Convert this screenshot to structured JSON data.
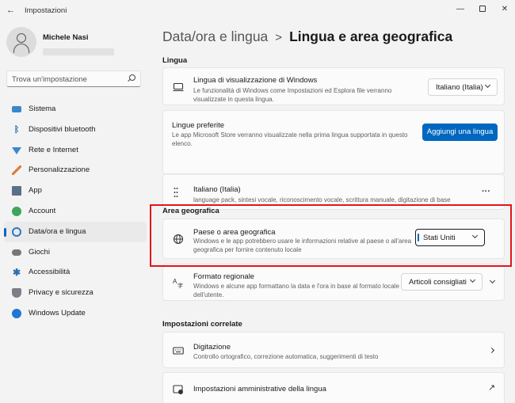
{
  "window": {
    "title": "Impostazioni",
    "back_glyph": "←",
    "minimize_glyph": "—",
    "close_glyph": "✕"
  },
  "user": {
    "name": "Michele Nasi"
  },
  "search": {
    "placeholder": "Trova un'impostazione"
  },
  "sidebar": {
    "items": [
      {
        "label": "Sistema",
        "icon": "system-icon"
      },
      {
        "label": "Dispositivi bluetooth",
        "icon": "bluetooth-icon",
        "glyph": "ᛒ"
      },
      {
        "label": "Rete e Internet",
        "icon": "wifi-icon"
      },
      {
        "label": "Personalizzazione",
        "icon": "brush-icon"
      },
      {
        "label": "App",
        "icon": "apps-icon"
      },
      {
        "label": "Account",
        "icon": "account-icon"
      },
      {
        "label": "Data/ora e lingua",
        "icon": "globe-clock-icon",
        "active": true
      },
      {
        "label": "Giochi",
        "icon": "gamepad-icon"
      },
      {
        "label": "Accessibilità",
        "icon": "accessibility-icon",
        "glyph": "✱"
      },
      {
        "label": "Privacy e sicurezza",
        "icon": "shield-icon"
      },
      {
        "label": "Windows Update",
        "icon": "update-icon"
      }
    ]
  },
  "breadcrumb": {
    "parent": "Data/ora e lingua",
    "separator": ">",
    "current": "Lingua e area geografica"
  },
  "sections": {
    "lingua": "Lingua",
    "area": "Area geografica",
    "correlate": "Impostazioni correlate"
  },
  "lingua": {
    "display": {
      "title": "Lingua di visualizzazione di Windows",
      "desc": "Le funzionalità di Windows come Impostazioni ed Esplora file verranno visualizzate in questa lingua.",
      "value": "Italiano (Italia)"
    },
    "preferred": {
      "title": "Lingue preferite",
      "desc": "Le app Microsoft Store verranno visualizzate nella prima lingua supportata in questo elenco.",
      "button": "Aggiungi una lingua"
    },
    "language": {
      "title": "Italiano (Italia)",
      "desc": "language pack, sintesi vocale, riconoscimento vocale, scrittura manuale, digitazione di base",
      "more": "···"
    }
  },
  "area": {
    "country": {
      "title": "Paese o area geografica",
      "desc": "Windows e le app potrebbero usare le informazioni relative al paese o all'area geografica per fornire contenuto locale",
      "value": "Stati Uniti"
    },
    "format": {
      "title": "Formato regionale",
      "desc": "Windows e alcune app formattano la data e l'ora in base al formato locale dell'utente.",
      "value": "Articoli consigliati"
    }
  },
  "correlate": {
    "typing": {
      "title": "Digitazione",
      "desc": "Controllo ortografico, correzione automatica, suggerimenti di testo"
    },
    "admin": {
      "title": "Impostazioni amministrative della lingua",
      "external_glyph": "↗"
    }
  },
  "colors": {
    "accent": "#0067c0",
    "highlight": "#e3151a",
    "background": "#f3f3f3"
  }
}
